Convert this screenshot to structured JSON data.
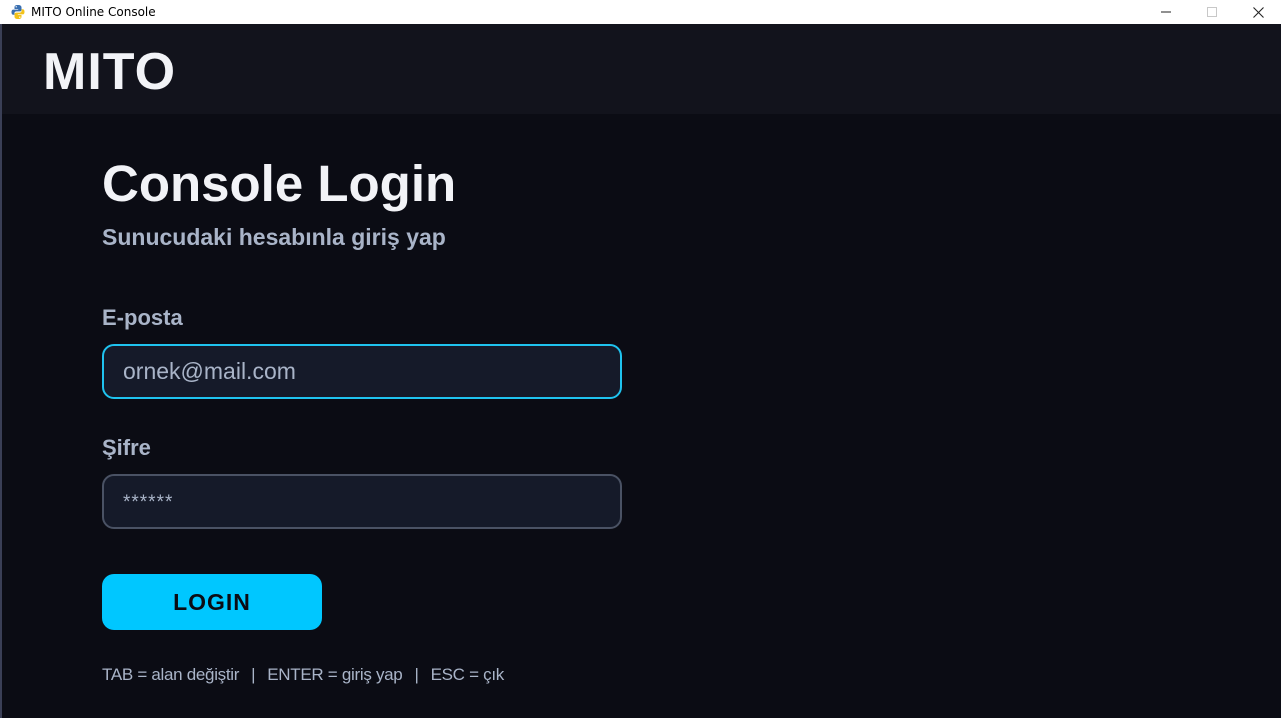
{
  "window": {
    "title": "MITO Online Console",
    "controls": {
      "minimize": "—",
      "maximize": "□",
      "close": "✕"
    }
  },
  "header": {
    "brand": "MITO"
  },
  "login": {
    "title": "Console Login",
    "subtitle": "Sunucudaki hesabınla giriş yap",
    "email_label": "E-posta",
    "email_value": "ornek@mail.com",
    "password_label": "Şifre",
    "password_value": "******",
    "button_label": "LOGIN"
  },
  "hints": [
    "TAB = alan değiştir",
    "ENTER = giriş yap",
    "ESC = çık"
  ],
  "hint_separator": "|",
  "colors": {
    "accent": "#00c7ff",
    "focus_border": "#1fc3ef",
    "background": "#0b0c14",
    "header_bg": "#12131c",
    "text_primary": "#f2f3f7",
    "text_muted": "#a9b4c8"
  },
  "icons": {
    "app": "python-icon"
  }
}
